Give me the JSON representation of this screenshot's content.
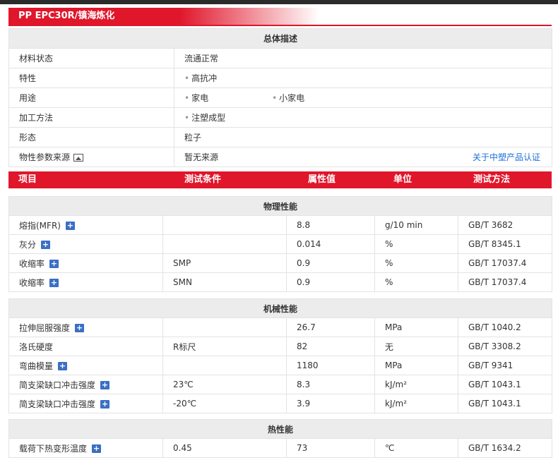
{
  "title": "PP EPC30R/镇海炼化",
  "overview": {
    "section_title": "总体描述",
    "rows": [
      {
        "label": "材料状态",
        "value": "流通正常"
      },
      {
        "label": "特性",
        "value": "高抗冲"
      },
      {
        "label": "用途",
        "value": "家电",
        "value2": "小家电"
      },
      {
        "label": "加工方法",
        "value": "注塑成型"
      },
      {
        "label": "形态",
        "value": "粒子"
      },
      {
        "label": "物性参数来源",
        "value": "暂无来源",
        "link": "关于中塑产品认证"
      }
    ]
  },
  "columns": [
    "项目",
    "测试条件",
    "属性值",
    "单位",
    "测试方法"
  ],
  "sections": {
    "physical": {
      "title": "物理性能",
      "rows": [
        {
          "item": "熔指(MFR)",
          "cond": "",
          "value": "8.8",
          "unit": "g/10 min",
          "method": "GB/T 3682"
        },
        {
          "item": "灰分",
          "cond": "",
          "value": "0.014",
          "unit": "%",
          "method": "GB/T 8345.1"
        },
        {
          "item": "收缩率",
          "cond": "SMP",
          "value": "0.9",
          "unit": "%",
          "method": "GB/T 17037.4"
        },
        {
          "item": "收缩率",
          "cond": "SMN",
          "value": "0.9",
          "unit": "%",
          "method": "GB/T 17037.4"
        }
      ]
    },
    "mechanical": {
      "title": "机械性能",
      "rows": [
        {
          "item": "拉伸屈服强度",
          "cond": "",
          "value": "26.7",
          "unit": "MPa",
          "method": "GB/T 1040.2"
        },
        {
          "item": "洛氏硬度",
          "cond": "R标尺",
          "value": "82",
          "unit": "无",
          "method": "GB/T 3308.2"
        },
        {
          "item": "弯曲模量",
          "cond": "",
          "value": "1180",
          "unit": "MPa",
          "method": "GB/T 9341"
        },
        {
          "item": "简支梁缺口冲击强度",
          "cond": "23℃",
          "value": "8.3",
          "unit": "kJ/m²",
          "method": "GB/T 1043.1"
        },
        {
          "item": "简支梁缺口冲击强度",
          "cond": "-20℃",
          "value": "3.9",
          "unit": "kJ/m²",
          "method": "GB/T 1043.1"
        }
      ]
    },
    "thermal": {
      "title": "热性能",
      "rows": [
        {
          "item": "载荷下热变形温度",
          "cond": "0.45",
          "value": "73",
          "unit": "℃",
          "method": "GB/T 1634.2"
        }
      ]
    }
  },
  "icons": {
    "plus": "expand-plus-icon",
    "image": "image-icon"
  },
  "colors": {
    "accent": "#e0162b",
    "link": "#1c6fd6",
    "plus": "#3a6fc4",
    "section_bg": "#ececec"
  }
}
